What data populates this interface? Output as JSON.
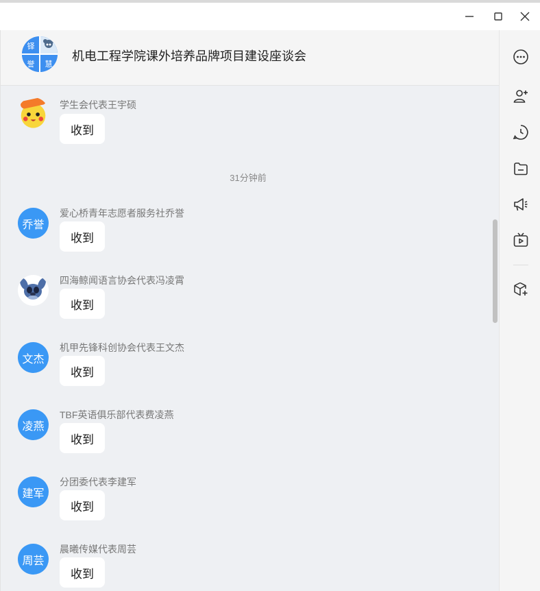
{
  "header": {
    "title": "机电工程学院课外培养品牌项目建设座谈会",
    "group_avatar_chars": [
      "铎",
      "誉",
      "慧"
    ]
  },
  "messages": [
    {
      "sender": "学生会代表王宇硕",
      "text": "收到",
      "avatar_text": ""
    },
    {
      "sender": "爱心桥青年志愿者服务社乔誉",
      "text": "收到",
      "avatar_text": "乔誉"
    },
    {
      "sender": "四海鲸闻语言协会代表冯凌霄",
      "text": "收到",
      "avatar_text": ""
    },
    {
      "sender": "机甲先锋科创协会代表王文杰",
      "text": "收到",
      "avatar_text": "文杰"
    },
    {
      "sender": "TBF英语俱乐部代表费凌燕",
      "text": "收到",
      "avatar_text": "凌燕"
    },
    {
      "sender": "分团委代表李建军",
      "text": "收到",
      "avatar_text": "建军"
    },
    {
      "sender": "晨曦传媒代表周芸",
      "text": "收到",
      "avatar_text": "周芸"
    }
  ],
  "timestamp": "31分钟前",
  "sidebar": [
    "more-icon",
    "add-member-icon",
    "history-icon",
    "folder-icon",
    "announcement-icon",
    "video-icon",
    "app-add-icon"
  ],
  "colors": {
    "avatar_blue": "#3a98f5",
    "chat_bg": "#eef0f3",
    "bubble": "#ffffff"
  }
}
